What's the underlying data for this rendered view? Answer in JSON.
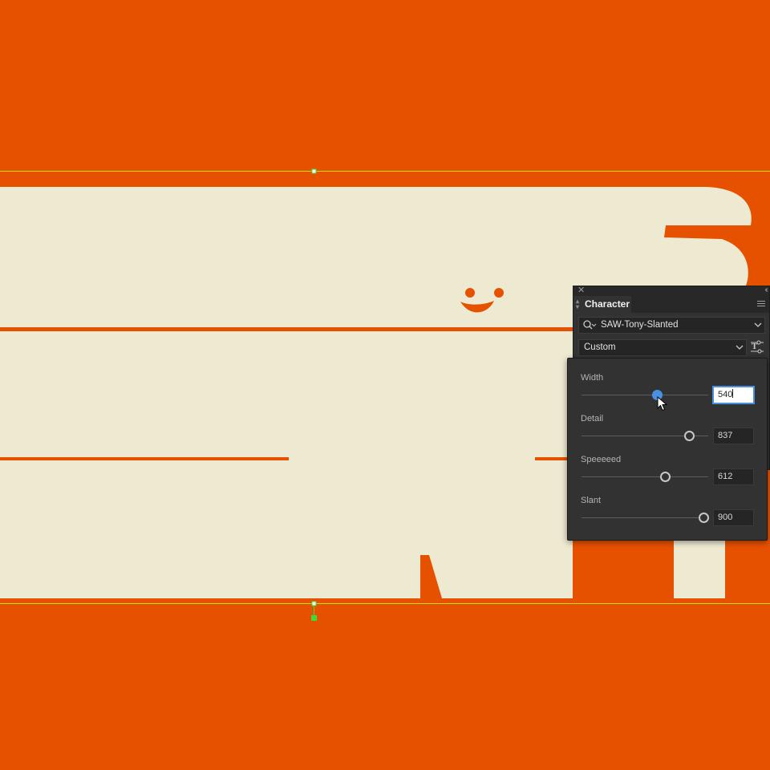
{
  "colors": {
    "background": "#e65100",
    "paper": "#eeead2",
    "panel": "#323232",
    "accent": "#4a90e2",
    "guide": "#c6e000",
    "handle": "#3ddc3d"
  },
  "panel": {
    "title": "Character",
    "font_family": "SAW-Tony-Slanted",
    "font_style": "Custom",
    "icons": [
      "close-icon",
      "collapse-icon",
      "panel-menu-icon",
      "search-icon",
      "chevron-down-icon",
      "variable-font-icon"
    ]
  },
  "variable_axes": [
    {
      "label": "Width",
      "value": "540",
      "level": 540,
      "max": 900,
      "active": true
    },
    {
      "label": "Detail",
      "value": "837",
      "level": 837,
      "max": 900,
      "active": false
    },
    {
      "label": "Speeeeed",
      "value": "612",
      "level": 612,
      "max": 900,
      "active": false
    },
    {
      "label": "Slant",
      "value": "900",
      "level": 900,
      "max": 900,
      "active": false
    }
  ]
}
